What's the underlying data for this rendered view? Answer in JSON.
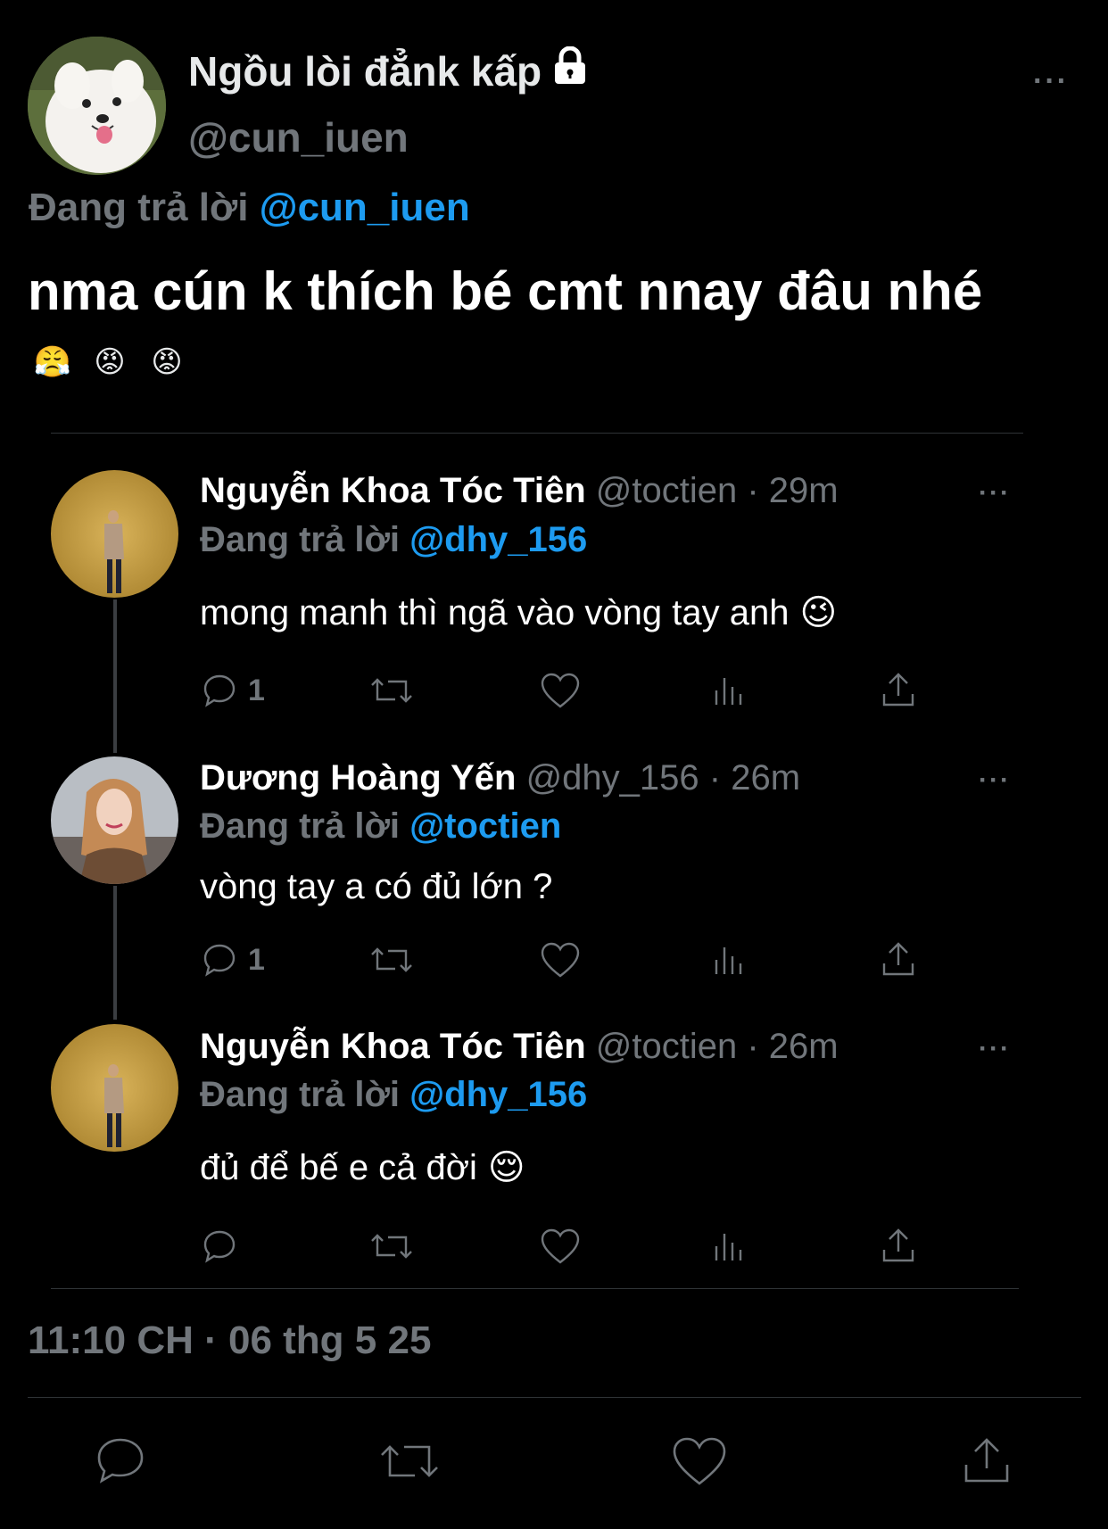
{
  "main_tweet": {
    "display_name": "Ngồu lòi đẳnk kấp",
    "handle": "@cun_iuen",
    "replying_label": "Đang trả lời",
    "replying_to": "@cun_iuen",
    "text": "nma cún k thích bé cmt nnay đâu nhé",
    "emojis": [
      "😤",
      "😡",
      "😡"
    ],
    "timestamp": "11:10 CH · 06 thg 5 25",
    "more": "···"
  },
  "replies": [
    {
      "name": "Nguyễn Khoa Tóc Tiên",
      "handle": "@toctien",
      "time": "· 29m",
      "replying_label": "Đang trả lời",
      "replying_to": "@dhy_156",
      "text": "mong manh thì ngã vào vòng tay anh",
      "emoji": "😉",
      "reply_count": "1",
      "more": "···"
    },
    {
      "name": "Dương Hoàng Yến",
      "handle": "@dhy_156",
      "time": "· 26m",
      "replying_label": "Đang trả lời",
      "replying_to": "@toctien",
      "text": "vòng tay a có đủ lớn ?",
      "emoji": "",
      "reply_count": "1",
      "more": "···"
    },
    {
      "name": "Nguyễn Khoa Tóc Tiên",
      "handle": "@toctien",
      "time": "· 26m",
      "replying_label": "Đang trả lời",
      "replying_to": "@dhy_156",
      "text": "đủ để bế e cả đời",
      "emoji": "😌",
      "reply_count": "",
      "more": "···"
    }
  ],
  "icons": {
    "lock": "lock-icon",
    "reply": "reply-icon",
    "retweet": "retweet-icon",
    "like": "heart-icon",
    "views": "views-icon",
    "share": "share-icon"
  },
  "colors": {
    "background": "#000000",
    "text": "#e7e9ea",
    "muted": "#71767b",
    "accent": "#1d9bf0"
  }
}
